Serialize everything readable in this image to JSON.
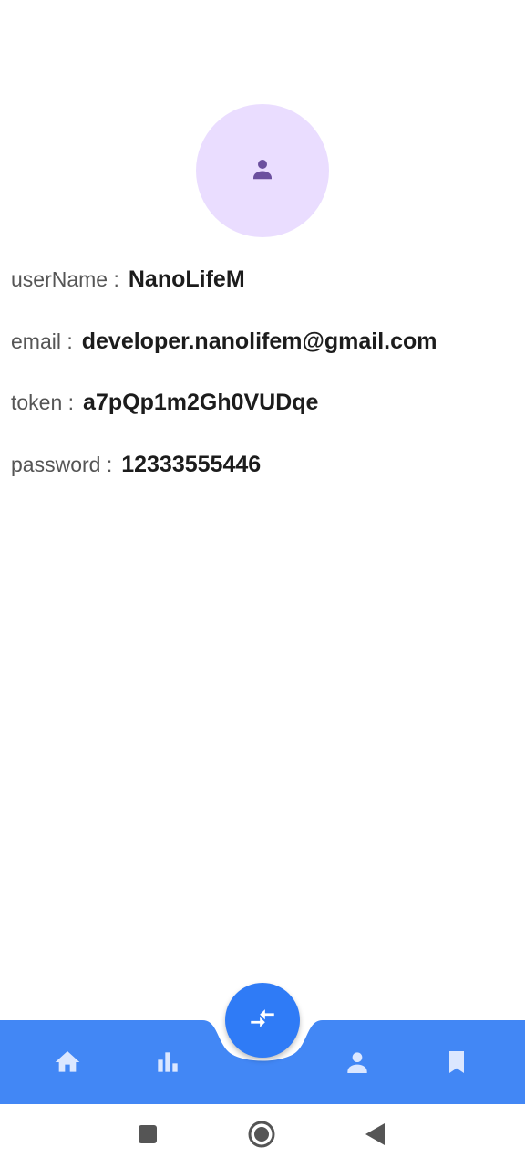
{
  "profile": {
    "avatar_icon": "person-icon",
    "fields": {
      "username": {
        "label": "userName : ",
        "value": "NanoLifeM"
      },
      "email": {
        "label": "email : ",
        "value": "developer.nanolifem@gmail.com"
      },
      "token": {
        "label": "token : ",
        "value": "a7pQp1m2Gh0VUDqe"
      },
      "password": {
        "label": "password : ",
        "value": "12333555446"
      }
    }
  },
  "bottom_nav": {
    "items": [
      {
        "icon": "home-icon"
      },
      {
        "icon": "bar-chart-icon"
      },
      {
        "icon": "person-icon"
      },
      {
        "icon": "bookmark-icon"
      }
    ],
    "fab_icon": "compress-arrows-icon"
  },
  "system_nav": {
    "buttons": [
      "recents-icon",
      "home-circle-icon",
      "back-triangle-icon"
    ]
  },
  "colors": {
    "nav_bar": "#4287f5",
    "fab": "#2f7bf6",
    "avatar_bg": "#eaddff",
    "avatar_icon": "#6b4f9e",
    "nav_icon": "#dbe7ff"
  }
}
